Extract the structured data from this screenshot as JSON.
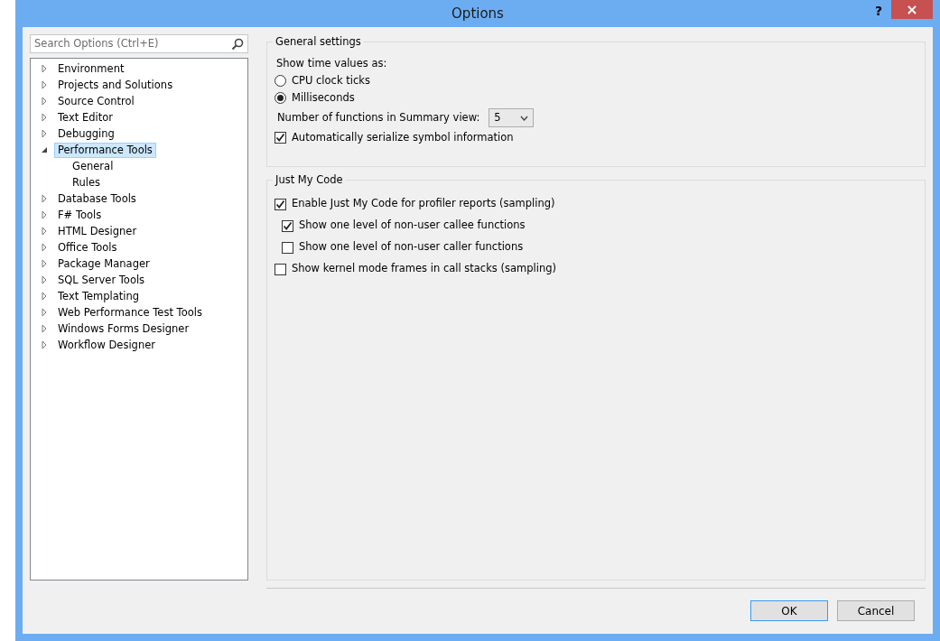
{
  "window": {
    "title": "Options",
    "help": "?",
    "close": "×"
  },
  "search": {
    "placeholder": "Search Options (Ctrl+E)"
  },
  "tree": [
    {
      "label": "Environment",
      "expanded": false,
      "selected": false
    },
    {
      "label": "Projects and Solutions",
      "expanded": false,
      "selected": false
    },
    {
      "label": "Source Control",
      "expanded": false,
      "selected": false
    },
    {
      "label": "Text Editor",
      "expanded": false,
      "selected": false
    },
    {
      "label": "Debugging",
      "expanded": false,
      "selected": false
    },
    {
      "label": "Performance Tools",
      "expanded": true,
      "selected": true,
      "children": [
        {
          "label": "General",
          "selected": false
        },
        {
          "label": "Rules",
          "selected": false
        }
      ]
    },
    {
      "label": "Database Tools",
      "expanded": false,
      "selected": false
    },
    {
      "label": "F# Tools",
      "expanded": false,
      "selected": false
    },
    {
      "label": "HTML Designer",
      "expanded": false,
      "selected": false
    },
    {
      "label": "Office Tools",
      "expanded": false,
      "selected": false
    },
    {
      "label": "Package Manager",
      "expanded": false,
      "selected": false
    },
    {
      "label": "SQL Server Tools",
      "expanded": false,
      "selected": false
    },
    {
      "label": "Text Templating",
      "expanded": false,
      "selected": false
    },
    {
      "label": "Web Performance Test Tools",
      "expanded": false,
      "selected": false
    },
    {
      "label": "Windows Forms Designer",
      "expanded": false,
      "selected": false
    },
    {
      "label": "Workflow Designer",
      "expanded": false,
      "selected": false
    }
  ],
  "general_settings": {
    "title": "General settings",
    "time_label": "Show time values as:",
    "radios": [
      {
        "label": "CPU clock ticks",
        "selected": false
      },
      {
        "label": "Milliseconds",
        "selected": true
      }
    ],
    "functions_label": "Number of functions in Summary view:",
    "functions_value": "5",
    "serialize": {
      "label": "Automatically serialize symbol information",
      "checked": true
    }
  },
  "just_my_code": {
    "title": "Just My Code",
    "options": [
      {
        "label": "Enable Just My Code for profiler reports (sampling)",
        "checked": true,
        "children": [
          {
            "label": "Show one level of non-user callee functions",
            "checked": true
          },
          {
            "label": "Show one level of non-user caller functions",
            "checked": false
          }
        ]
      },
      {
        "label": "Show kernel mode frames in call stacks (sampling)",
        "checked": false
      }
    ]
  },
  "buttons": [
    "OK",
    "Cancel"
  ]
}
